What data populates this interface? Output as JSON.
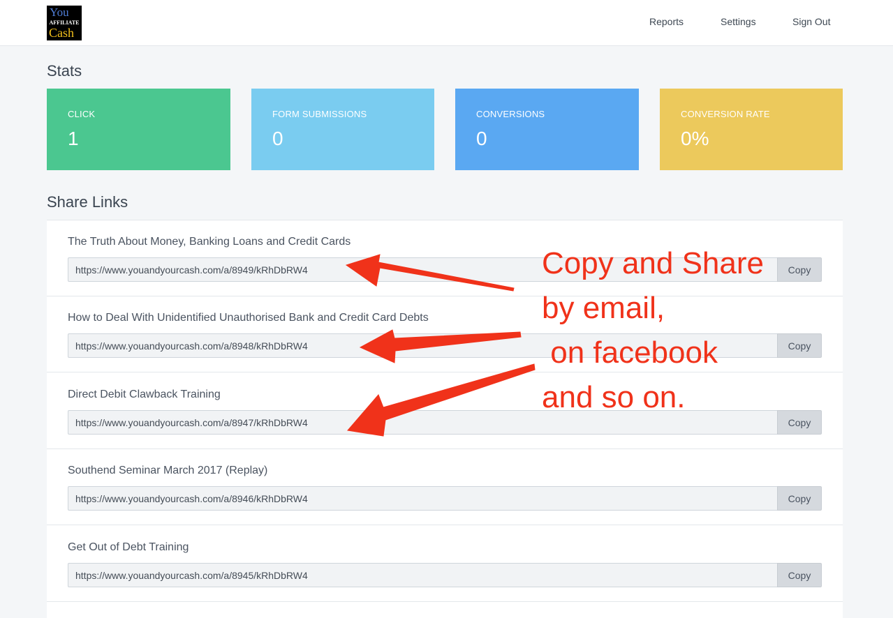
{
  "header": {
    "logo": {
      "line1": "You",
      "line2": "AFFILIATE",
      "line3": "Cash"
    },
    "nav": [
      {
        "label": "Reports"
      },
      {
        "label": "Settings"
      },
      {
        "label": "Sign Out"
      }
    ]
  },
  "stats": {
    "title": "Stats",
    "cards": [
      {
        "label": "CLICK",
        "value": "1",
        "color": "#4bc790"
      },
      {
        "label": "FORM SUBMISSIONS",
        "value": "0",
        "color": "#7accf0"
      },
      {
        "label": "CONVERSIONS",
        "value": "0",
        "color": "#5aa8f2"
      },
      {
        "label": "CONVERSION RATE",
        "value": "0%",
        "color": "#ecc95c"
      }
    ]
  },
  "share_links": {
    "title": "Share Links",
    "copy_label": "Copy",
    "items": [
      {
        "title": "The Truth About Money, Banking Loans and Credit Cards",
        "url": "https://www.youandyourcash.com/a/8949/kRhDbRW4"
      },
      {
        "title": "How to Deal With Unidentified Unauthorised Bank and Credit Card Debts",
        "url": "https://www.youandyourcash.com/a/8948/kRhDbRW4"
      },
      {
        "title": "Direct Debit Clawback Training",
        "url": "https://www.youandyourcash.com/a/8947/kRhDbRW4"
      },
      {
        "title": "Southend Seminar March 2017 (Replay)",
        "url": "https://www.youandyourcash.com/a/8946/kRhDbRW4"
      },
      {
        "title": "Get Out of Debt Training",
        "url": "https://www.youandyourcash.com/a/8945/kRhDbRW4"
      }
    ]
  },
  "annotation": {
    "text": "Copy and Share\nby email,\n on facebook\nand so on.",
    "color": "#f0321a"
  }
}
